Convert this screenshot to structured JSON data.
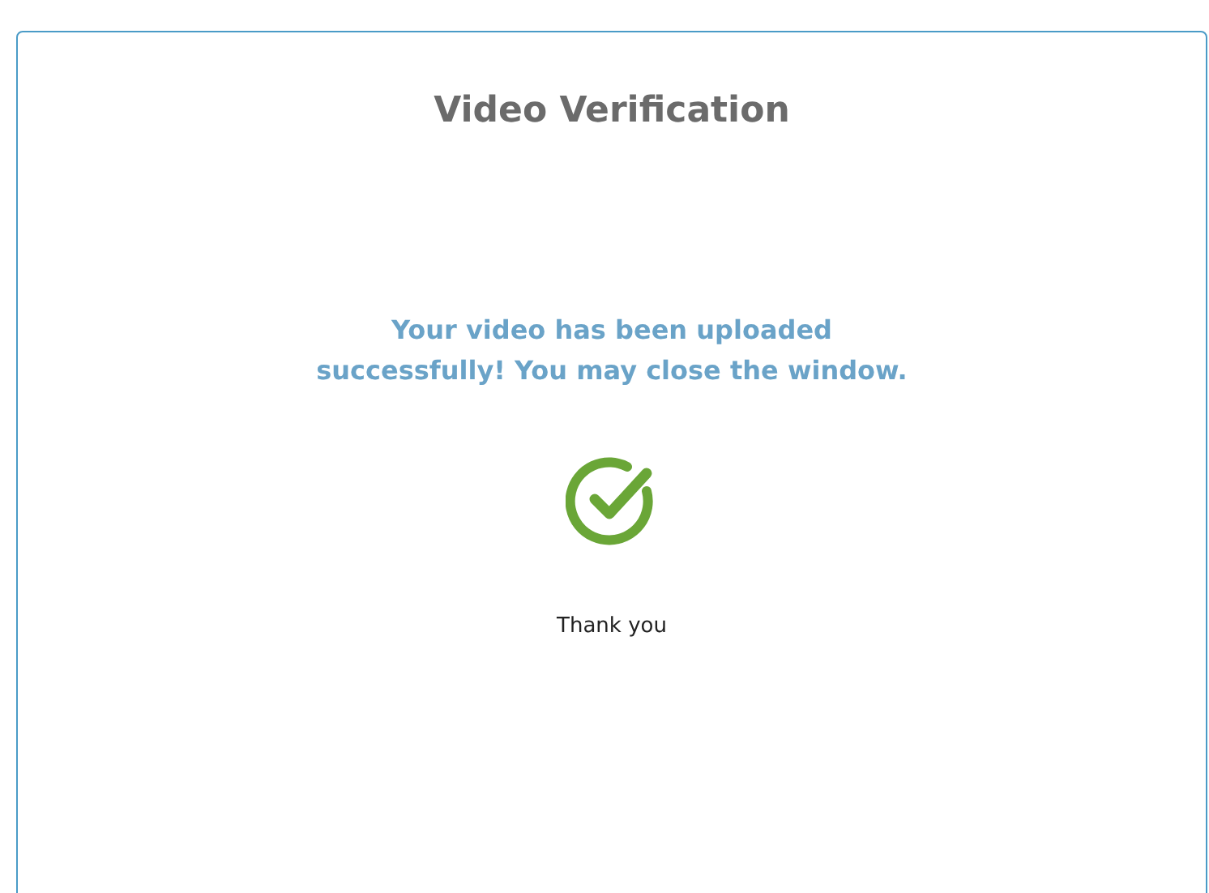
{
  "title": "Video Verification",
  "message": "Your video has been uploaded successfully! You may close the window.",
  "thanks": "Thank you"
}
